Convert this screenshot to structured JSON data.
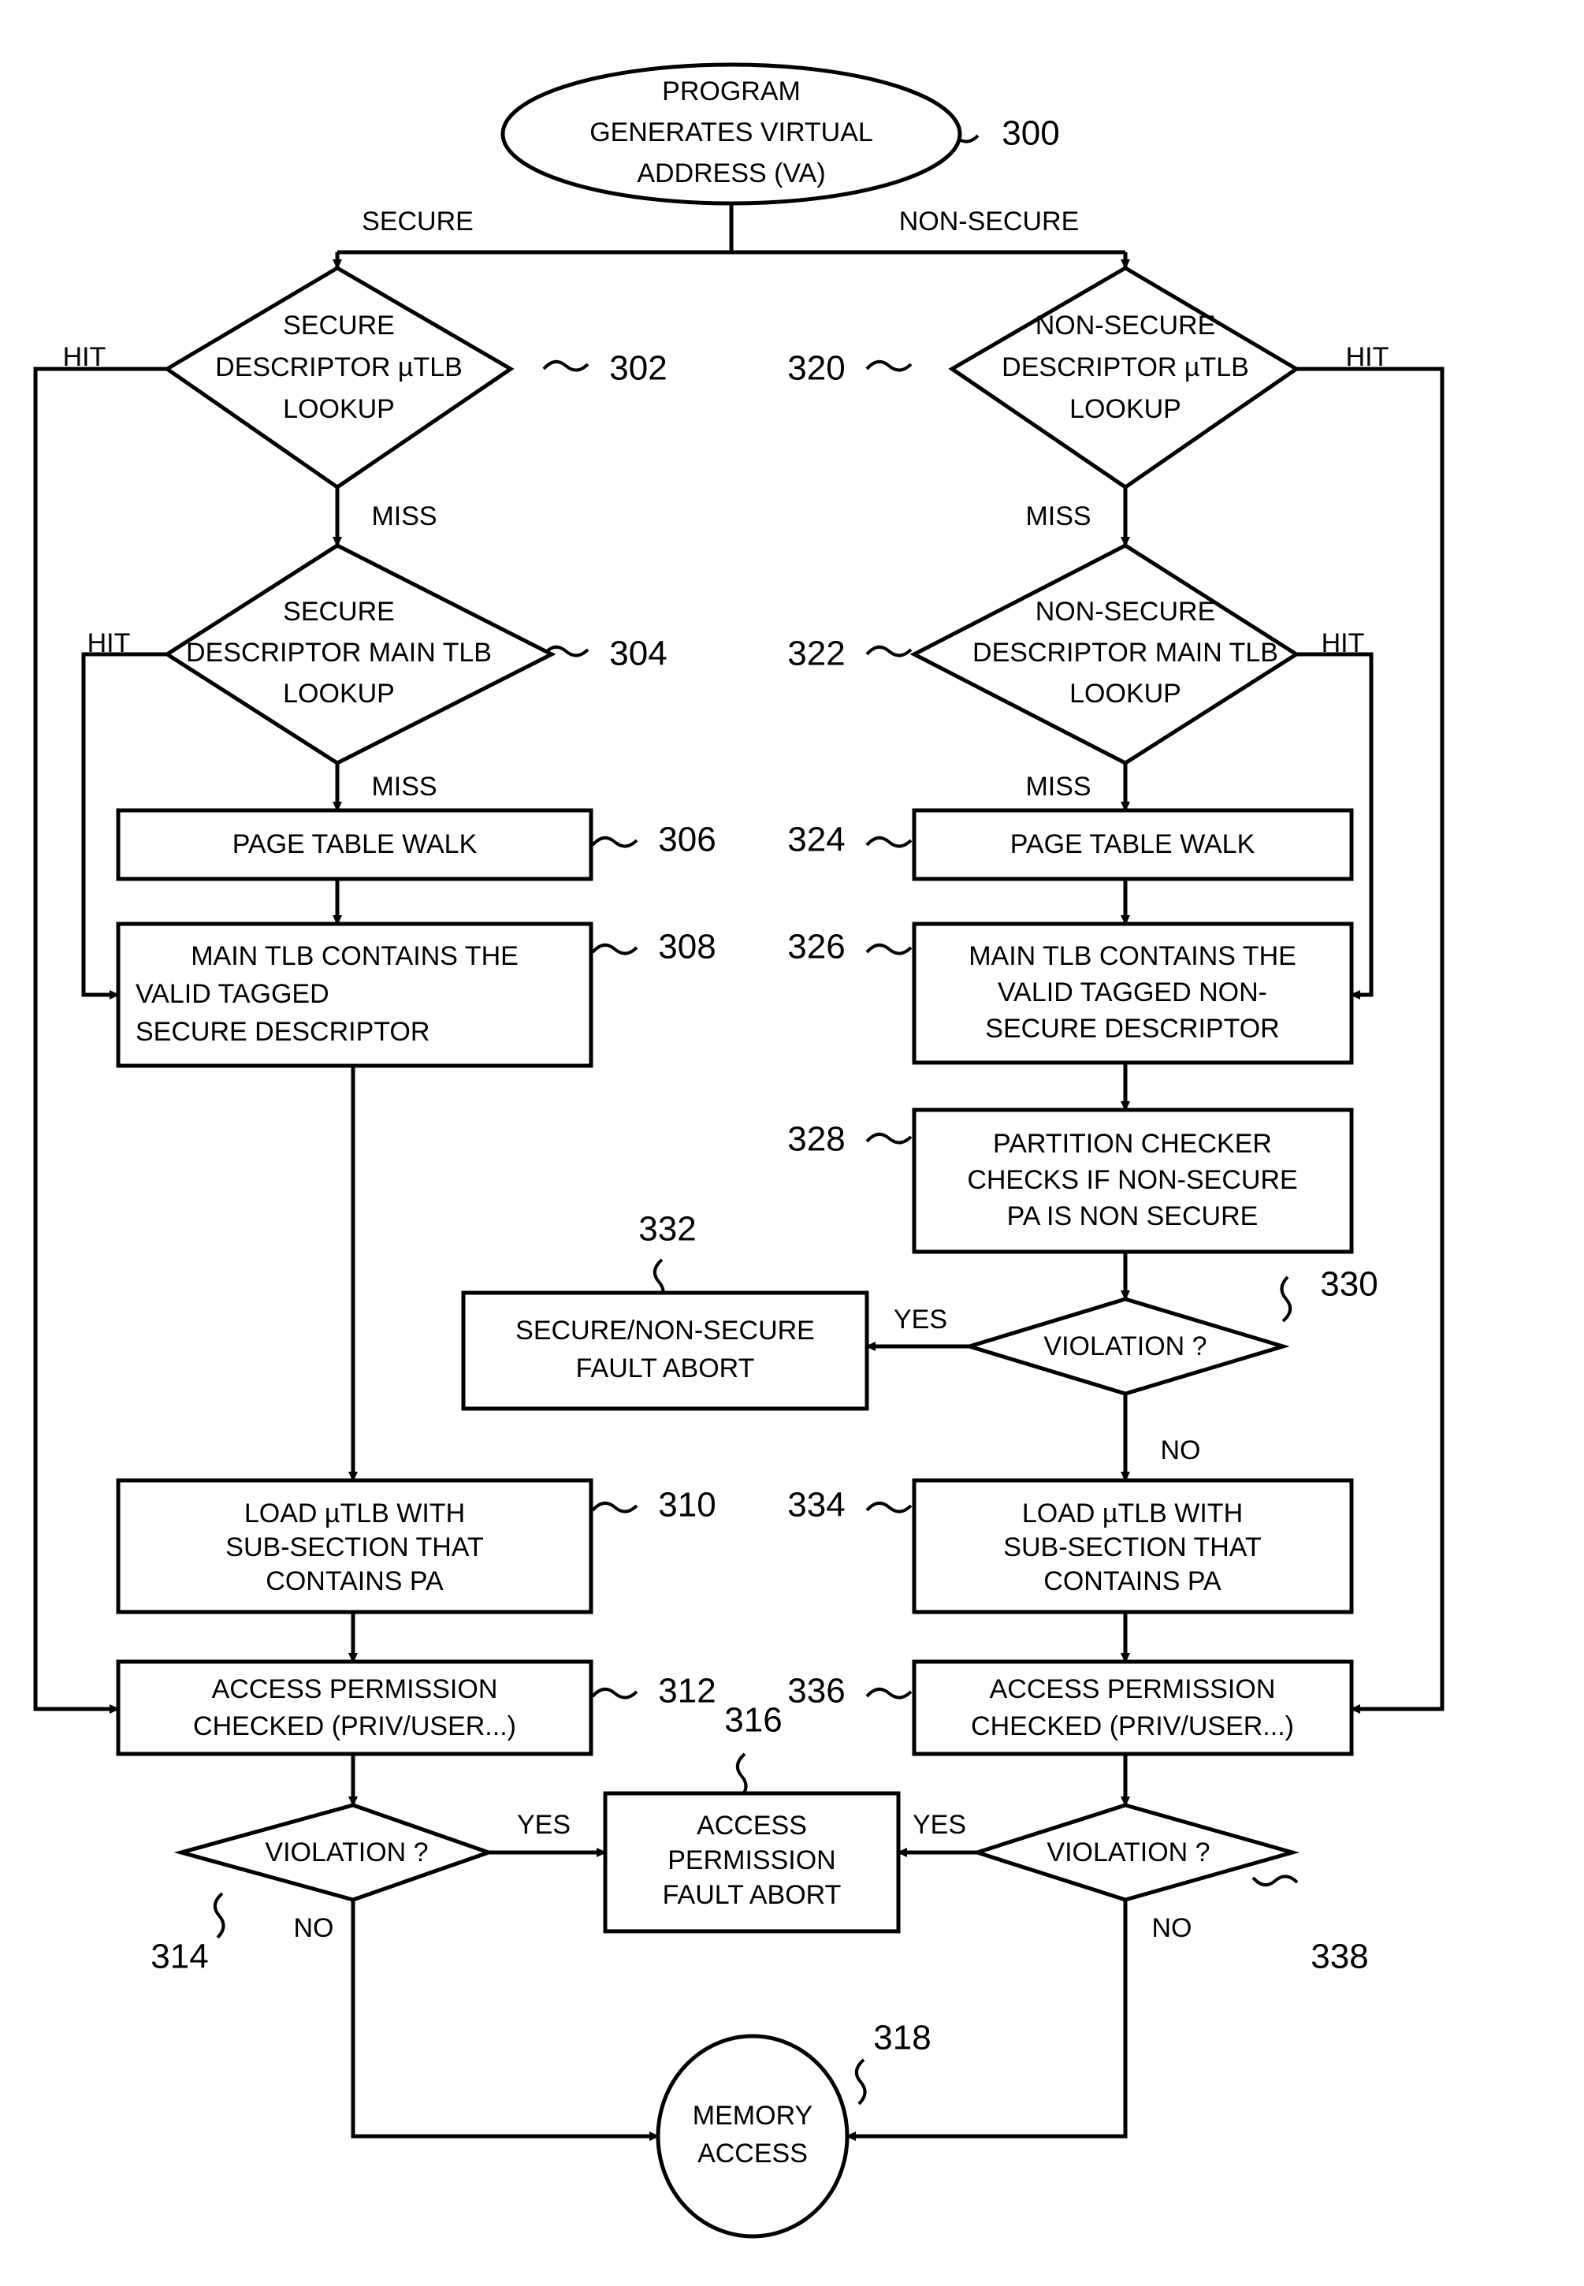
{
  "figure": {
    "type": "flowchart",
    "title": "Secure / Non-Secure virtual address translation flow",
    "background_color": "#ffffff",
    "line_color": "#000000"
  },
  "nodes": {
    "start": {
      "ref": "300",
      "shape": "ellipse",
      "lines": [
        "PROGRAM",
        "GENERATES VIRTUAL",
        "ADDRESS (VA)"
      ]
    },
    "n302": {
      "ref": "302",
      "shape": "diamond",
      "lines": [
        "SECURE",
        "DESCRIPTOR µTLB",
        "LOOKUP"
      ]
    },
    "n304": {
      "ref": "304",
      "shape": "diamond",
      "lines": [
        "SECURE",
        "DESCRIPTOR MAIN TLB",
        "LOOKUP"
      ]
    },
    "n306": {
      "ref": "306",
      "shape": "rect",
      "lines": [
        "PAGE TABLE WALK"
      ]
    },
    "n308": {
      "ref": "308",
      "shape": "rect",
      "align": "left",
      "lines": [
        "MAIN TLB CONTAINS THE",
        "VALID TAGGED",
        "SECURE DESCRIPTOR"
      ]
    },
    "n310": {
      "ref": "310",
      "shape": "rect",
      "lines": [
        "LOAD µTLB WITH",
        "SUB-SECTION THAT",
        "CONTAINS PA"
      ]
    },
    "n312": {
      "ref": "312",
      "shape": "rect",
      "lines": [
        "ACCESS PERMISSION",
        "CHECKED (PRIV/USER...)"
      ]
    },
    "n314": {
      "ref": "314",
      "shape": "diamond",
      "lines": [
        "VIOLATION ?"
      ]
    },
    "n316": {
      "ref": "316",
      "shape": "rect",
      "lines": [
        "ACCESS",
        "PERMISSION",
        "FAULT ABORT"
      ]
    },
    "n318": {
      "ref": "318",
      "shape": "ellipse",
      "lines": [
        "MEMORY",
        "ACCESS"
      ]
    },
    "n320": {
      "ref": "320",
      "shape": "diamond",
      "lines": [
        "NON-SECURE",
        "DESCRIPTOR µTLB",
        "LOOKUP"
      ]
    },
    "n322": {
      "ref": "322",
      "shape": "diamond",
      "lines": [
        "NON-SECURE",
        "DESCRIPTOR MAIN TLB",
        "LOOKUP"
      ]
    },
    "n324": {
      "ref": "324",
      "shape": "rect",
      "lines": [
        "PAGE TABLE WALK"
      ]
    },
    "n326": {
      "ref": "326",
      "shape": "rect",
      "lines": [
        "MAIN TLB CONTAINS THE",
        "VALID TAGGED NON-",
        "SECURE DESCRIPTOR"
      ]
    },
    "n328": {
      "ref": "328",
      "shape": "rect",
      "lines": [
        "PARTITION CHECKER",
        "CHECKS IF NON-SECURE",
        "PA IS NON SECURE"
      ]
    },
    "n330": {
      "ref": "330",
      "shape": "diamond",
      "lines": [
        "VIOLATION ?"
      ]
    },
    "n332": {
      "ref": "332",
      "shape": "rect",
      "lines": [
        "SECURE/NON-SECURE",
        "FAULT ABORT"
      ]
    },
    "n334": {
      "ref": "334",
      "shape": "rect",
      "lines": [
        "LOAD µTLB WITH",
        "SUB-SECTION THAT",
        "CONTAINS PA"
      ]
    },
    "n336": {
      "ref": "336",
      "shape": "rect",
      "lines": [
        "ACCESS PERMISSION",
        "CHECKED (PRIV/USER...)"
      ]
    },
    "n338": {
      "ref": "338",
      "shape": "diamond",
      "lines": [
        "VIOLATION ?"
      ]
    }
  },
  "edge_labels": {
    "secure": "SECURE",
    "non_secure": "NON-SECURE",
    "hit_left_utlb": "HIT",
    "hit_left_main": "HIT",
    "hit_right_utlb": "HIT",
    "hit_right_main": "HIT",
    "miss_left_utlb": "MISS",
    "miss_left_main": "MISS",
    "miss_right_utlb": "MISS",
    "miss_right_main": "MISS",
    "yes_330": "YES",
    "no_330": "NO",
    "yes_314": "YES",
    "no_314": "NO",
    "yes_338": "YES",
    "no_338": "NO"
  }
}
